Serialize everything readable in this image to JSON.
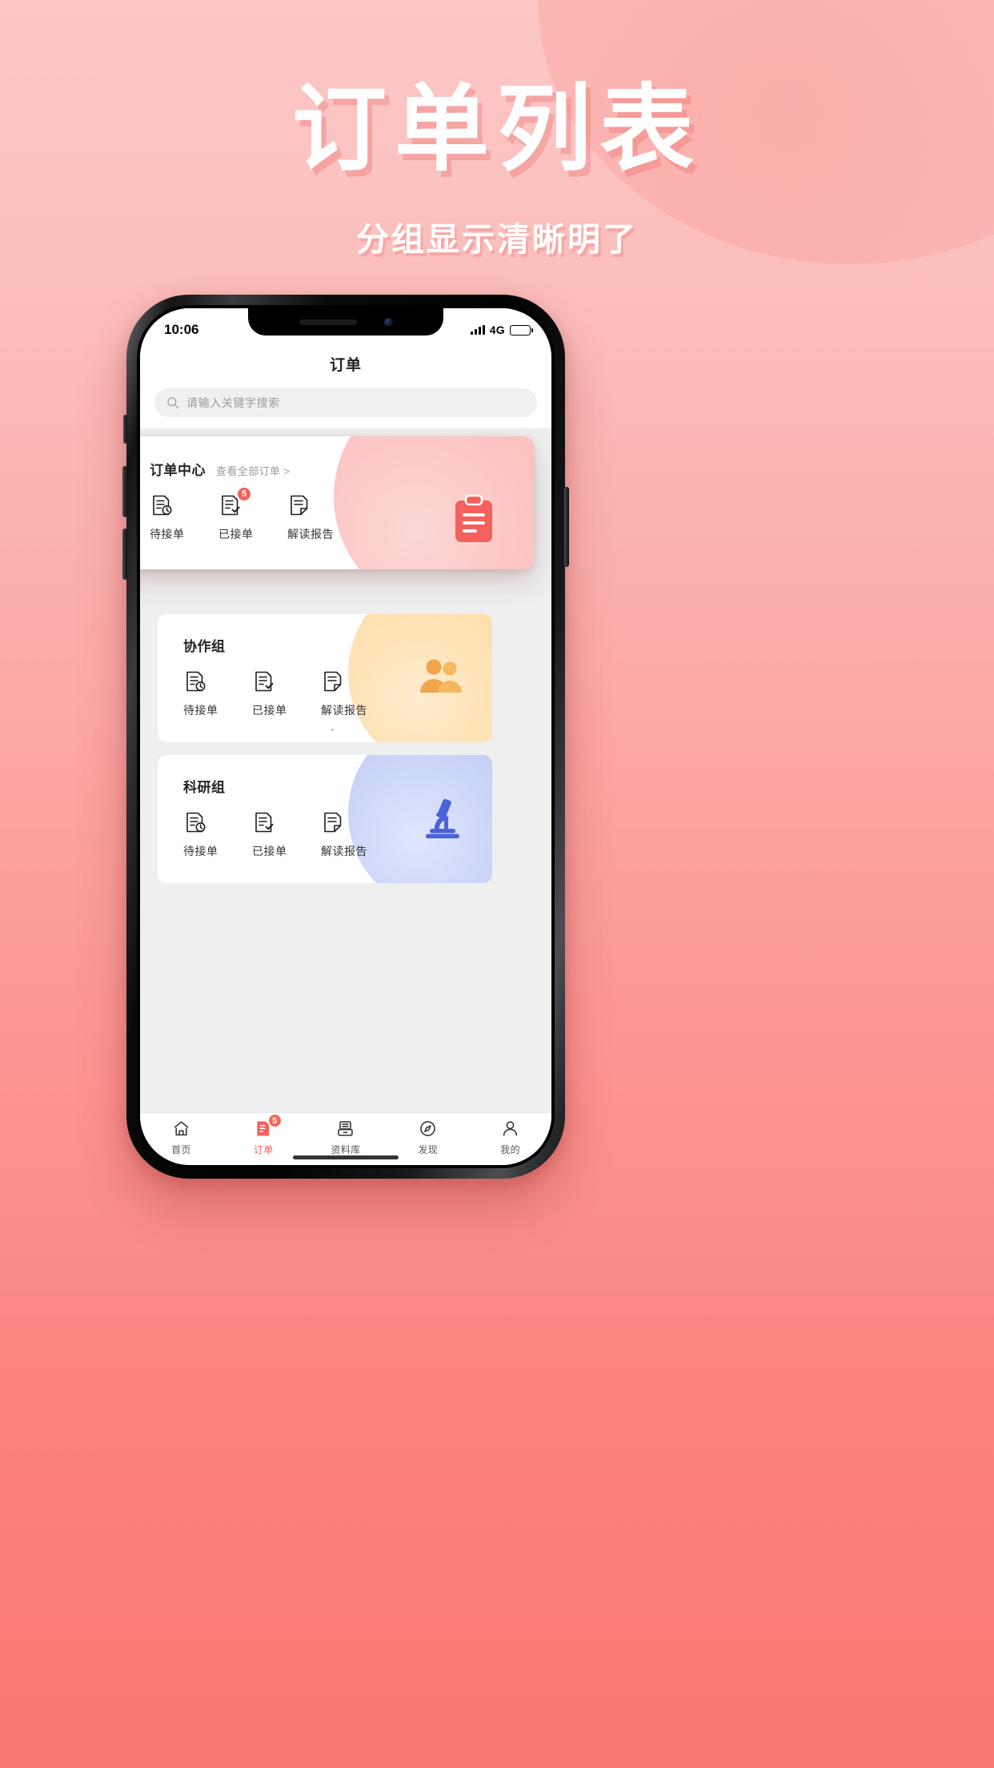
{
  "poster": {
    "title": "订单列表",
    "subtitle": "分组显示清晰明了",
    "background_color": "#fbbdbb",
    "accent_color": "#f4615c"
  },
  "status_bar": {
    "time": "10:06",
    "network": "4G",
    "signal_icon": "signal-bars-icon",
    "battery_icon": "battery-icon"
  },
  "navbar": {
    "title": "订单"
  },
  "search": {
    "icon": "search-icon",
    "placeholder": "请输入关键字搜索",
    "value": ""
  },
  "order_center": {
    "title": "订单中心",
    "link": "查看全部订单 >",
    "art_icon": "clipboard-icon",
    "items": [
      {
        "label": "待接单",
        "icon": "doc-clock-icon",
        "badge": ""
      },
      {
        "label": "已接单",
        "icon": "doc-check-icon",
        "badge": "5"
      },
      {
        "label": "解读报告",
        "icon": "doc-fold-icon",
        "badge": ""
      }
    ]
  },
  "groups": [
    {
      "title": "协作组",
      "art_icon": "people-icon",
      "accent": "#f5a84b",
      "items": [
        {
          "label": "待接单",
          "icon": "doc-clock-icon",
          "badge": ""
        },
        {
          "label": "已接单",
          "icon": "doc-check-icon",
          "badge": ""
        },
        {
          "label": "解读报告",
          "icon": "doc-fold-icon",
          "badge": ""
        }
      ]
    },
    {
      "title": "科研组",
      "art_icon": "microscope-icon",
      "accent": "#5a73df",
      "items": [
        {
          "label": "待接单",
          "icon": "doc-clock-icon",
          "badge": ""
        },
        {
          "label": "已接单",
          "icon": "doc-check-icon",
          "badge": ""
        },
        {
          "label": "解读报告",
          "icon": "doc-fold-icon",
          "badge": ""
        }
      ]
    }
  ],
  "tabbar": {
    "items": [
      {
        "label": "首页",
        "icon": "home-icon",
        "badge": "",
        "active": false
      },
      {
        "label": "订单",
        "icon": "order-icon",
        "badge": "5",
        "active": true
      },
      {
        "label": "资料库",
        "icon": "library-icon",
        "badge": "",
        "active": false
      },
      {
        "label": "发现",
        "icon": "compass-icon",
        "badge": "",
        "active": false
      },
      {
        "label": "我的",
        "icon": "person-icon",
        "badge": "",
        "active": false
      }
    ]
  }
}
